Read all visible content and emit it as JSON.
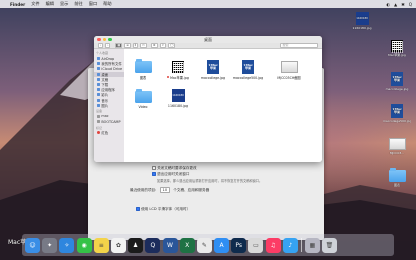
{
  "menubar": {
    "apple": "",
    "app": "Finder",
    "items": [
      "文件",
      "编辑",
      "显示",
      "前往",
      "窗口",
      "帮助"
    ],
    "right": [
      "◐",
      "▲",
      "✱",
      "Q"
    ]
  },
  "window": {
    "title": "桌面",
    "search_placeholder": "搜索"
  },
  "sidebar": {
    "sections": [
      {
        "head": "个人收藏",
        "items": [
          "AirDrop",
          "我的所有文件",
          "iCloud Drive",
          "桌面",
          "文稿",
          "下载",
          "应用程序",
          "影片",
          "音乐",
          "图片"
        ]
      },
      {
        "head": "设备",
        "items": [
          "mac",
          "BOOTCAMP"
        ]
      },
      {
        "head": "标记",
        "items": [
          "红色"
        ]
      }
    ],
    "selected": "桌面"
  },
  "files": [
    {
      "name": "图表",
      "kind": "folder"
    },
    {
      "name": "Mac苹果.jpg",
      "kind": "qr",
      "tagged": true
    },
    {
      "name": "maccollege.jpg",
      "kind": "mac"
    },
    {
      "name": "maccollege500.jpg",
      "kind": "mac"
    },
    {
      "name": "MJCC03CH截图",
      "kind": "shot"
    },
    {
      "name": "Video",
      "kind": "folder"
    },
    {
      "name": "1160180.jpg",
      "kind": "blue"
    }
  ],
  "prefs": {
    "lines": [
      "关闭文稿时要求保存更改",
      "退出应用时关闭窗口",
      "如果选择，那么退出应用后重新打开应用时，将不恢复打开的文稿和窗口。",
      "最近使用的项目:",
      "10",
      "个文稿、应用和服务器",
      "使用 LCD 平滑字体（可用时）"
    ]
  },
  "desktop_icons": [
    {
      "name": "1160180.jpg",
      "kind": "blue"
    },
    {
      "name": "Mac苹果.jpg",
      "kind": "qr"
    },
    {
      "name": "maccollege.jpg",
      "kind": "mac"
    },
    {
      "name": "maccollege500.jpg",
      "kind": "mac"
    },
    {
      "name": "MJCC03...",
      "kind": "shot"
    },
    {
      "name": "图表",
      "kind": "folder"
    }
  ],
  "dock": {
    "label": "Mac苹果",
    "apps": [
      {
        "name": "Finder",
        "color": "#3a8ee6",
        "glyph": "☺"
      },
      {
        "name": "Launchpad",
        "color": "#777a86",
        "glyph": "✦"
      },
      {
        "name": "Safari",
        "color": "#2e86de",
        "glyph": "✧"
      },
      {
        "name": "WeChat",
        "color": "#35c247",
        "glyph": "◉"
      },
      {
        "name": "Notes",
        "color": "#f3d34a",
        "glyph": "≡"
      },
      {
        "name": "Photos",
        "color": "#f2f2f2",
        "glyph": "✿"
      },
      {
        "name": "QQ",
        "color": "#1b1b1b",
        "glyph": "♟"
      },
      {
        "name": "Quicktime",
        "color": "#1c2c5c",
        "glyph": "Q"
      },
      {
        "name": "Word",
        "color": "#2a5699",
        "glyph": "W"
      },
      {
        "name": "Excel",
        "color": "#1f7244",
        "glyph": "X"
      },
      {
        "name": "Keynote",
        "color": "#eaeaea",
        "glyph": "✎"
      },
      {
        "name": "App Store",
        "color": "#2f8ef3",
        "glyph": "A"
      },
      {
        "name": "Photoshop",
        "color": "#0f2b4d",
        "glyph": "Ps"
      },
      {
        "name": "Preview",
        "color": "#d9d9d9",
        "glyph": "▭"
      },
      {
        "name": "iTunes",
        "color": "#fc3c65",
        "glyph": "♫"
      },
      {
        "name": "QQ Music",
        "color": "#36a3f2",
        "glyph": "♪"
      }
    ],
    "right": [
      {
        "name": "Downloads",
        "color": "#b6b6c2",
        "glyph": "▦"
      },
      {
        "name": "Trash",
        "color": "#cfd2d8",
        "glyph": "🗑"
      }
    ]
  }
}
